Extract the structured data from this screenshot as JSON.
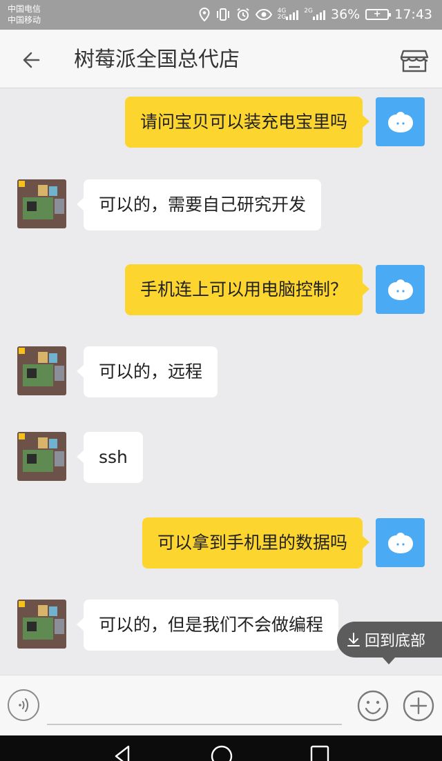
{
  "status_bar": {
    "carrier1": "中国电信",
    "carrier2": "中国移动",
    "sig1_top": "4G",
    "sig1_bottom": "2G",
    "sig2_top": "2G",
    "battery_percent": "36%",
    "time": "17:43",
    "icons": [
      "location-icon",
      "vibrate-icon",
      "alarm-icon",
      "eye-icon",
      "signal-icon",
      "battery-charging-icon"
    ]
  },
  "header": {
    "title": "树莓派全国总代店",
    "back_icon": "back-arrow-icon",
    "store_icon": "store-icon"
  },
  "messages": [
    {
      "side": "right",
      "text": "请问宝贝可以装充电宝里吗"
    },
    {
      "side": "left",
      "text": "可以的，需要自己研究开发"
    },
    {
      "side": "right",
      "text": "手机连上可以用电脑控制？"
    },
    {
      "side": "left",
      "text": "可以的，远程"
    },
    {
      "side": "left",
      "text": "ssh"
    },
    {
      "side": "right",
      "text": "可以拿到手机里的数据吗"
    },
    {
      "side": "left",
      "text": "可以的，但是我们不会做编程"
    }
  ],
  "back_to_bottom": {
    "label": "回到底部",
    "icon": "download-arrow-icon"
  },
  "input_bar": {
    "placeholder": "",
    "voice_icon": "voice-icon",
    "emoji_icon": "emoji-icon",
    "plus_icon": "plus-icon"
  },
  "nav_bar": {
    "icons": [
      "nav-back-icon",
      "nav-home-icon",
      "nav-recents-icon"
    ]
  },
  "colors": {
    "status_bar": "#9e9e9e",
    "background": "#ebebed",
    "bubble_self": "#fcd52f",
    "bubble_other": "#ffffff",
    "avatar_self": "#4aaaf4"
  }
}
